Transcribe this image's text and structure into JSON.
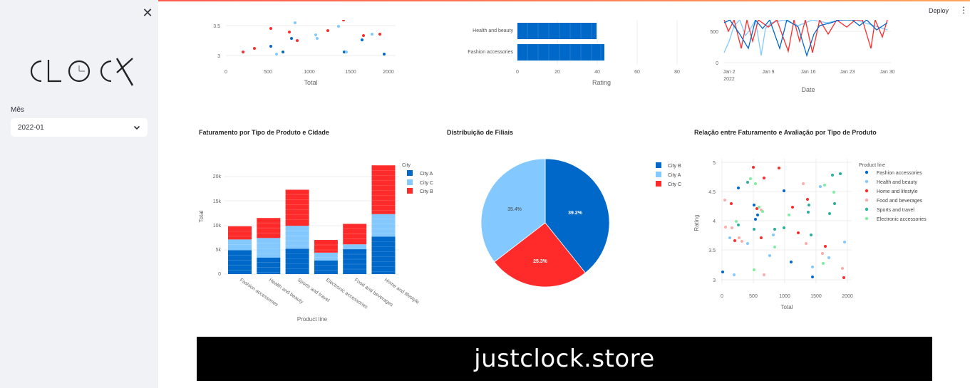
{
  "header": {
    "deploy_label": "Deploy",
    "menu_icon": "kebab-menu-icon",
    "close_icon": "close-icon"
  },
  "sidebar": {
    "logo_text": "CLOCK",
    "filter_label": "Mês",
    "filter_value": "2022-01"
  },
  "colors": {
    "city_a": "#0068c9",
    "city_c": "#83c9ff",
    "city_b": "#ff2b2b"
  },
  "charts": {
    "top_scatter": {
      "ticks_x": [
        "0",
        "500",
        "1000",
        "1500",
        "2000"
      ],
      "ticks_y": [
        "3.5",
        "3"
      ],
      "xlabel": "Total"
    },
    "top_bar": {
      "categories": [
        "Health and beauty",
        "Fashion accessories"
      ],
      "ticks_x": [
        "0",
        "20",
        "40",
        "60",
        "80"
      ],
      "xlabel": "Rating"
    },
    "top_line": {
      "ticks_x": [
        "Jan 2",
        "Jan 9",
        "Jan 16",
        "Jan 23",
        "Jan 30"
      ],
      "year": "2022",
      "ticks_y": [
        "500",
        "0"
      ],
      "xlabel": "Date"
    },
    "stacked": {
      "title": "Faturamento por Tipo de Produto e Cidade",
      "ylabel": "Total",
      "xlabel": "Product line",
      "ticks_y": [
        "20k",
        "15k",
        "10k",
        "5k",
        "0"
      ],
      "legend_title": "City",
      "legend": [
        "City A",
        "City C",
        "City B"
      ]
    },
    "pie": {
      "title": "Distribuição de Filiais",
      "legend": [
        "City B",
        "City A",
        "City C"
      ]
    },
    "scatter": {
      "title": "Relação entre Faturamento e Avaliação por Tipo de Produto",
      "ylabel": "Rating",
      "xlabel": "Total",
      "ticks_y": [
        "5",
        "4.5",
        "4",
        "3.5",
        "3"
      ],
      "ticks_x": [
        "0",
        "500",
        "1000",
        "1500",
        "2000"
      ],
      "legend_title": "Product line",
      "legend": [
        "Fashion accessories",
        "Health and beauty",
        "Home and lifestyle",
        "Food and beverages",
        "Sports and travel",
        "Electronic accessories"
      ],
      "legend_colors": [
        "#0068c9",
        "#83c9ff",
        "#ff2b2b",
        "#ffabab",
        "#29b09d",
        "#7defa1"
      ]
    }
  },
  "chart_data": [
    {
      "type": "bar",
      "categories": [
        "Health and beauty",
        "Fashion accessories"
      ],
      "values": [
        40,
        44
      ],
      "xlabel": "Rating",
      "xlim": [
        0,
        80
      ]
    },
    {
      "type": "bar",
      "stacked": true,
      "title": "Faturamento por Tipo de Produto e Cidade",
      "categories": [
        "Fashion accessories",
        "Health and beauty",
        "Sports and travel",
        "Electronic accessories",
        "Food and beverages",
        "Home and lifestyle"
      ],
      "series": [
        {
          "name": "City A",
          "values": [
            4900,
            3400,
            5200,
            2800,
            5100,
            7700
          ]
        },
        {
          "name": "City C",
          "values": [
            2200,
            4000,
            4700,
            1600,
            1000,
            4600
          ]
        },
        {
          "name": "City B",
          "values": [
            2700,
            4100,
            7400,
            2600,
            4200,
            10000
          ]
        }
      ],
      "xlabel": "Product line",
      "ylabel": "Total",
      "ylim": [
        0,
        22500
      ]
    },
    {
      "type": "pie",
      "title": "Distribuição de Filiais",
      "labels": [
        "City B",
        "City A",
        "City C"
      ],
      "values": [
        25.3,
        39.2,
        35.4
      ]
    }
  ],
  "labels": {
    "pie_a": "39.2%",
    "pie_b": "25.3%",
    "pie_c": "35.4%"
  },
  "banner": {
    "text": "justclock.store"
  }
}
